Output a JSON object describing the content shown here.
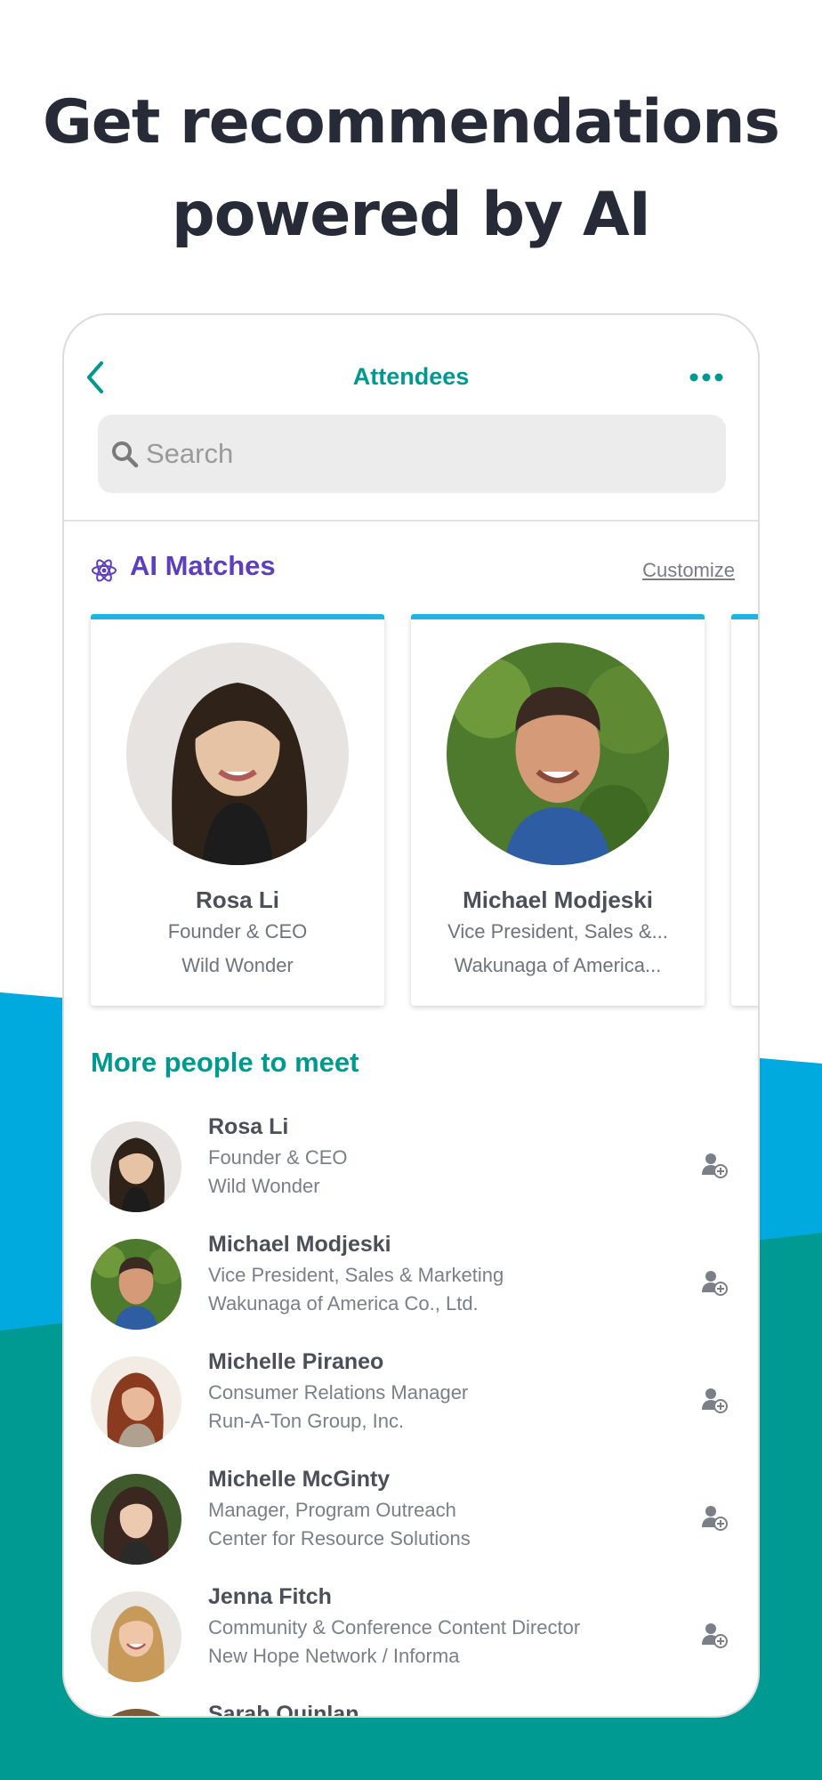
{
  "headline": {
    "line1": "Get recommendations",
    "line2": "powered by AI"
  },
  "nav": {
    "title": "Attendees",
    "back_icon": "chevron-left-icon",
    "more_icon": "more-dots-icon"
  },
  "search": {
    "placeholder": "Search"
  },
  "ai_section": {
    "title": "AI Matches",
    "icon": "atom-icon",
    "customize_label": "Customize"
  },
  "ai_matches": [
    {
      "name": "Rosa Li",
      "title": "Founder & CEO",
      "company": "Wild Wonder"
    },
    {
      "name": "Michael Modjeski",
      "title": "Vice President, Sales &...",
      "company": "Wakunaga of America..."
    }
  ],
  "more_section": {
    "title": "More people to meet"
  },
  "people": [
    {
      "name": "Rosa Li",
      "title": "Founder & CEO",
      "company": "Wild Wonder"
    },
    {
      "name": "Michael Modjeski",
      "title": "Vice President, Sales & Marketing",
      "company": "Wakunaga of America Co., Ltd."
    },
    {
      "name": "Michelle Piraneo",
      "title": "Consumer Relations Manager",
      "company": "Run-A-Ton Group, Inc."
    },
    {
      "name": "Michelle McGinty",
      "title": "Manager, Program Outreach",
      "company": "Center for Resource Solutions"
    },
    {
      "name": "Jenna Fitch",
      "title": "Community & Conference Content Director",
      "company": "New Hope Network / Informa"
    },
    {
      "name": "Sarah Quinlan",
      "title": "",
      "company": ""
    }
  ],
  "colors": {
    "teal": "#00998f",
    "purple": "#5d3fbd",
    "blue_band": "#00aadf",
    "teal_band": "#009a93",
    "card_accent": "#1fb3e0"
  }
}
